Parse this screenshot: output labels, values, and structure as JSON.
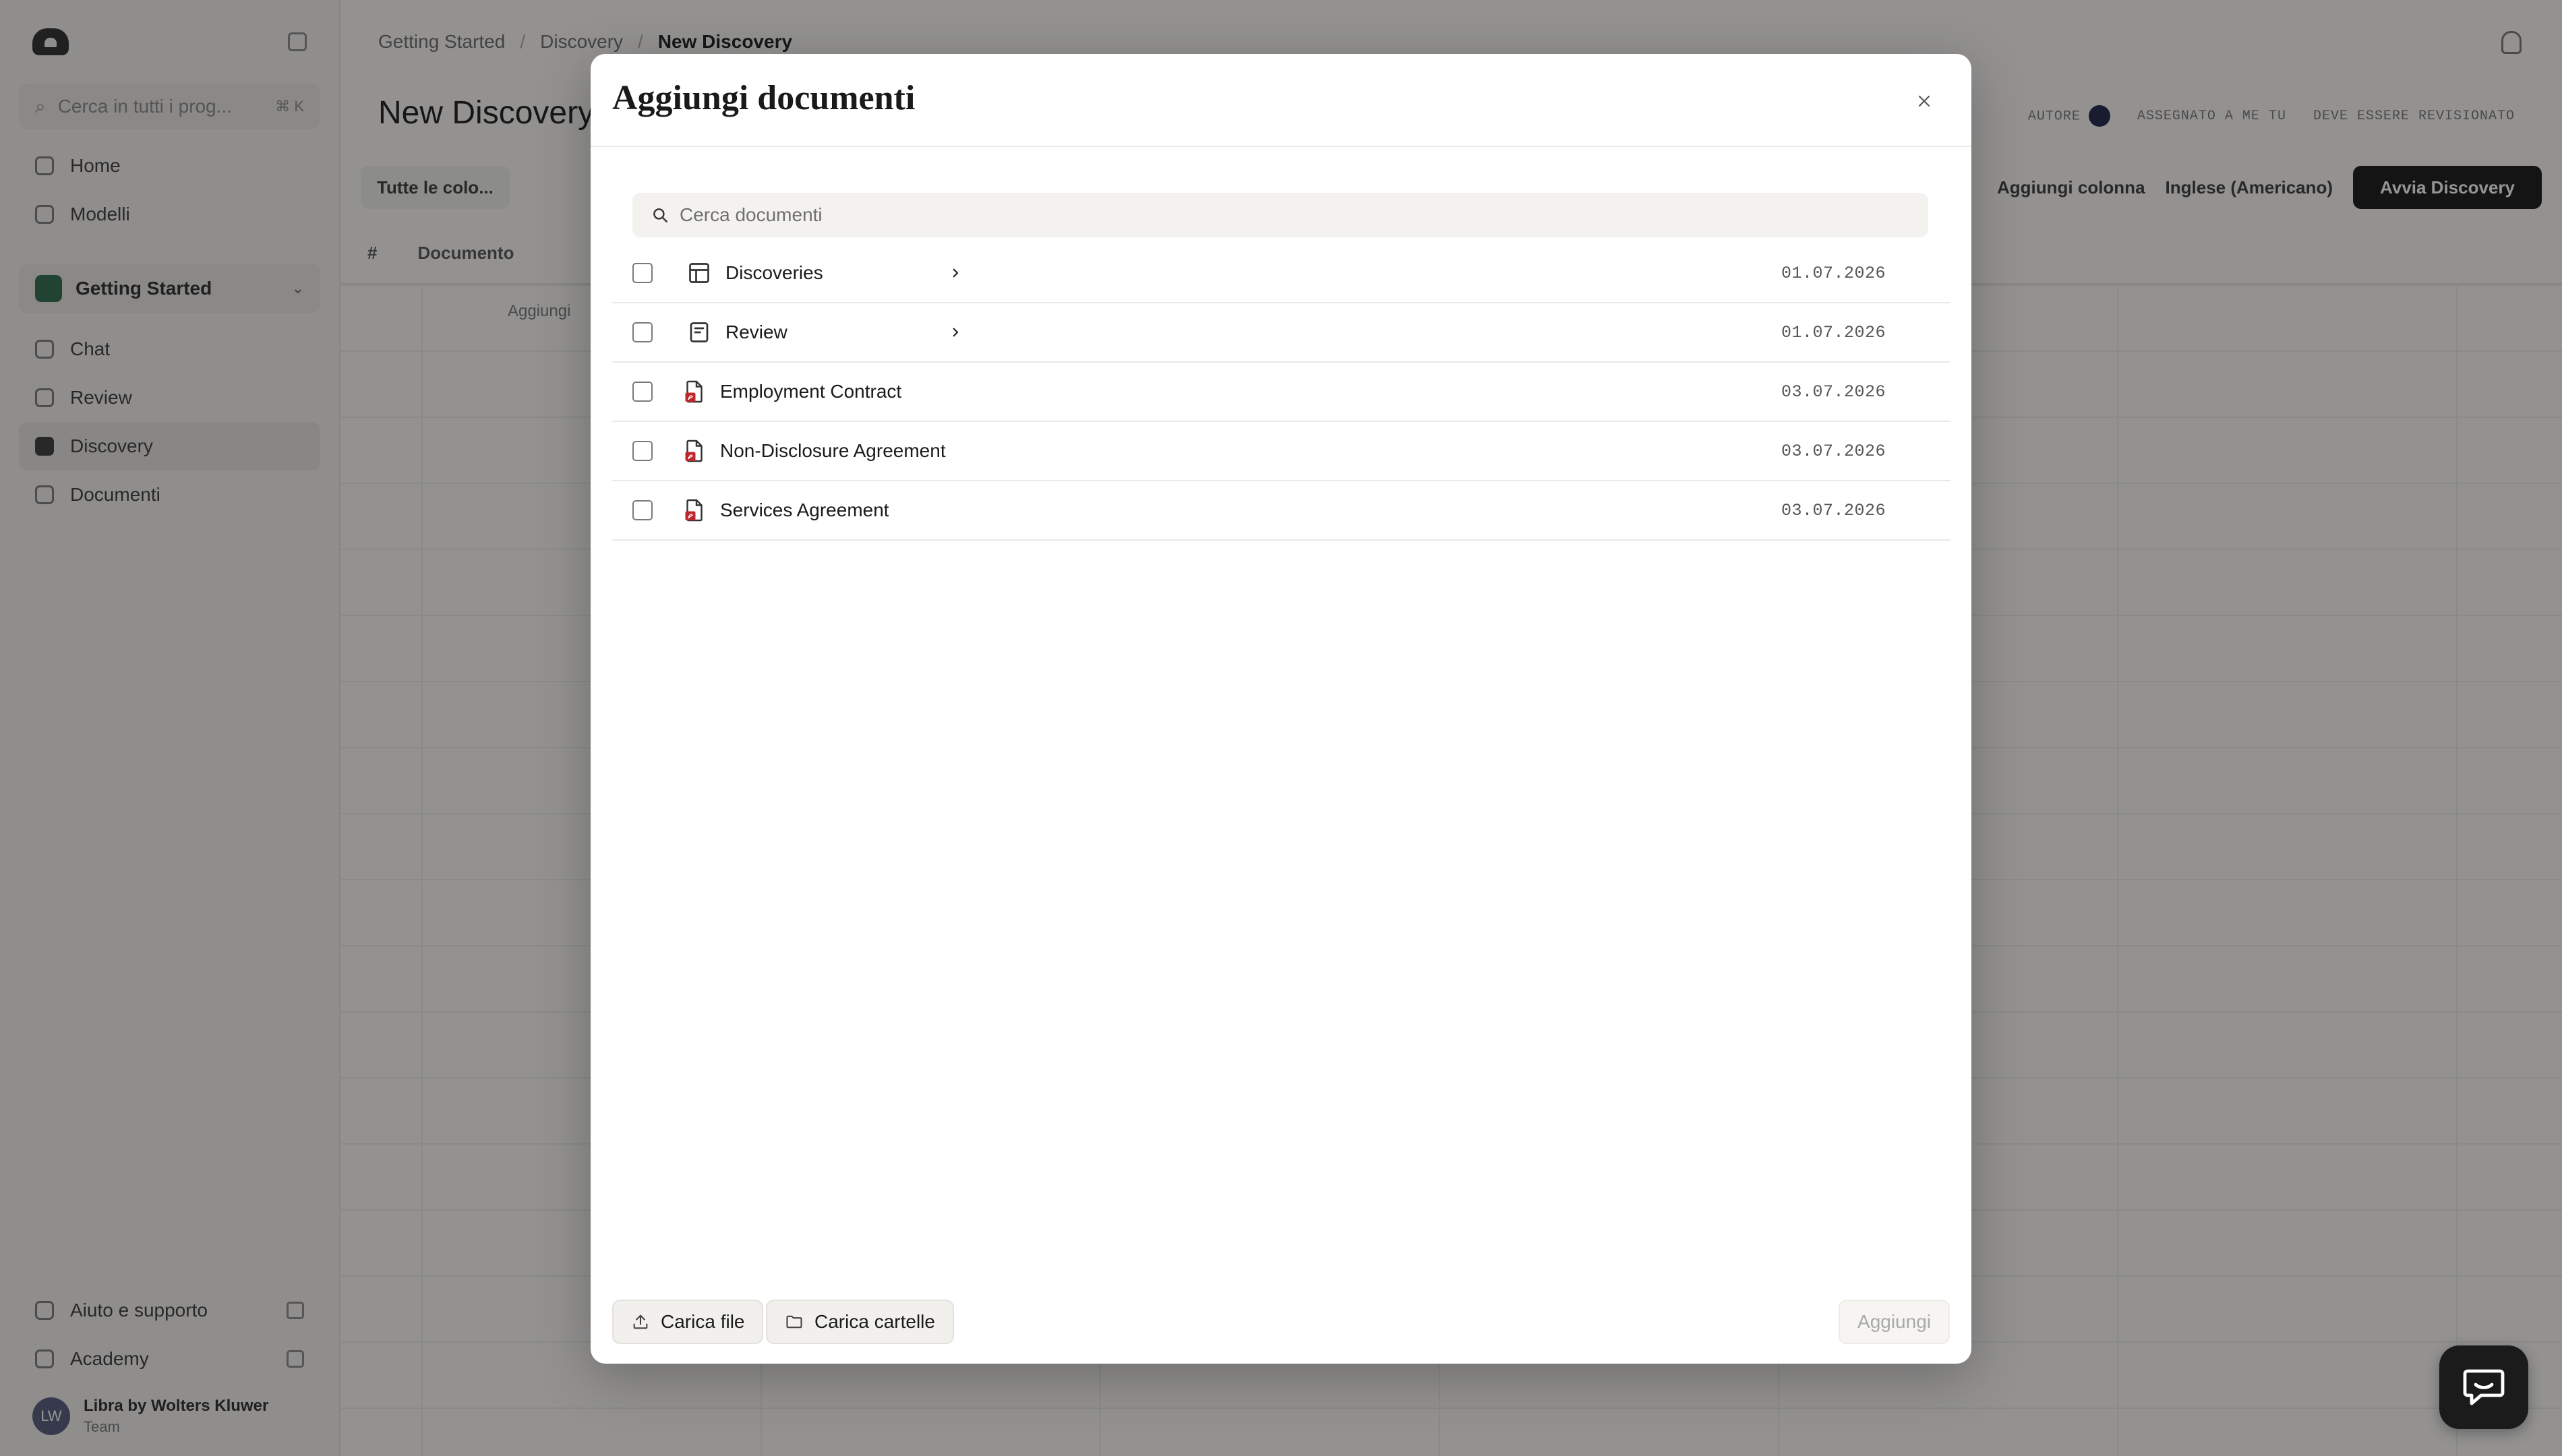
{
  "sidebar": {
    "search_placeholder": "Cerca in tutti i prog...",
    "search_shortcut": "⌘ K",
    "nav_top": [
      {
        "label": "Home",
        "icon": "home-icon"
      },
      {
        "label": "Modelli",
        "icon": "template-icon"
      }
    ],
    "project": {
      "label": "Getting Started",
      "icon": "project-icon"
    },
    "nav_project": [
      {
        "label": "Chat",
        "icon": "chat-icon"
      },
      {
        "label": "Review",
        "icon": "review-icon"
      },
      {
        "label": "Discovery",
        "icon": "discovery-icon",
        "active": true
      },
      {
        "label": "Documenti",
        "icon": "documents-icon"
      }
    ],
    "nav_bottom": [
      {
        "label": "Aiuto e supporto",
        "icon": "help-icon"
      },
      {
        "label": "Academy",
        "icon": "academy-icon"
      }
    ],
    "user": {
      "initials": "LW",
      "name": "Libra by Wolters Kluwer",
      "subtitle": "Team"
    }
  },
  "header": {
    "breadcrumbs": [
      "Getting Started",
      "Discovery",
      "New Discovery"
    ],
    "page_title": "New Discovery",
    "meta": [
      "AUTORE",
      "ASSEGNATO A ME TU",
      "DEVE ESSERE REVISIONATO"
    ]
  },
  "toolbar": {
    "view_chip": "Tutte le colo...",
    "add_column": "Aggiungi colonna",
    "language": "Inglese (Americano)",
    "primary": "Avvia Discovery"
  },
  "grid": {
    "columns": [
      "#",
      "Documento"
    ],
    "add_row": "Aggiungi"
  },
  "modal": {
    "title": "Aggiungi documenti",
    "search_placeholder": "Cerca documenti",
    "items": [
      {
        "name": "Discoveries",
        "date": "01.07.2026",
        "type": "folder-table",
        "icon": "table-icon",
        "has_children": true
      },
      {
        "name": "Review",
        "date": "01.07.2026",
        "type": "folder-review",
        "icon": "review-document-icon",
        "has_children": true
      },
      {
        "name": "Employment Contract",
        "date": "03.07.2026",
        "type": "pdf",
        "icon": "pdf-file-icon",
        "has_children": false
      },
      {
        "name": "Non-Disclosure Agreement",
        "date": "03.07.2026",
        "type": "pdf",
        "icon": "pdf-file-icon",
        "has_children": false
      },
      {
        "name": "Services Agreement",
        "date": "03.07.2026",
        "type": "pdf",
        "icon": "pdf-file-icon",
        "has_children": false
      }
    ],
    "upload_file_label": "Carica file",
    "upload_folder_label": "Carica cartelle",
    "add_label": "Aggiungi",
    "add_disabled": true
  },
  "colors": {
    "overlay": "#141414",
    "pdf_red": "#c0272d",
    "primary_button": "#151515",
    "modal_background": "#ffffff"
  }
}
